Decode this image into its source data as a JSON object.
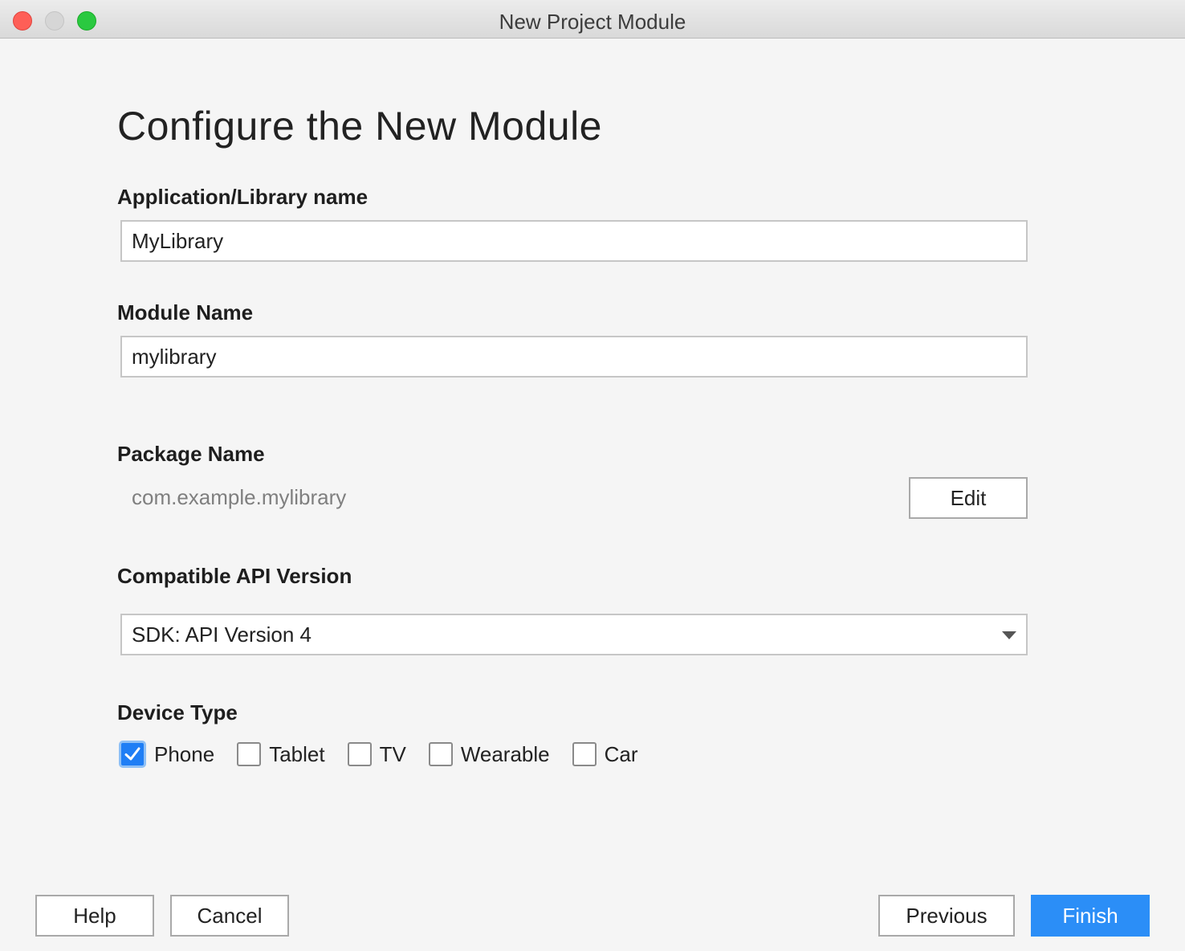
{
  "window": {
    "title": "New Project Module"
  },
  "page": {
    "heading": "Configure the New Module"
  },
  "app_name": {
    "label": "Application/Library name",
    "value": "MyLibrary"
  },
  "module_name": {
    "label": "Module Name",
    "value": "mylibrary"
  },
  "package_name": {
    "label": "Package Name",
    "value": "com.example.mylibrary",
    "edit_label": "Edit"
  },
  "api_version": {
    "label": "Compatible API Version",
    "selected": "SDK: API Version 4"
  },
  "device_type": {
    "label": "Device Type",
    "options": [
      {
        "label": "Phone",
        "checked": true
      },
      {
        "label": "Tablet",
        "checked": false
      },
      {
        "label": "TV",
        "checked": false
      },
      {
        "label": "Wearable",
        "checked": false
      },
      {
        "label": "Car",
        "checked": false
      }
    ]
  },
  "footer": {
    "help_label": "Help",
    "cancel_label": "Cancel",
    "previous_label": "Previous",
    "finish_label": "Finish"
  },
  "colors": {
    "accent": "#2b8ef7",
    "close": "#fe5f57",
    "maximize": "#2ac940"
  }
}
